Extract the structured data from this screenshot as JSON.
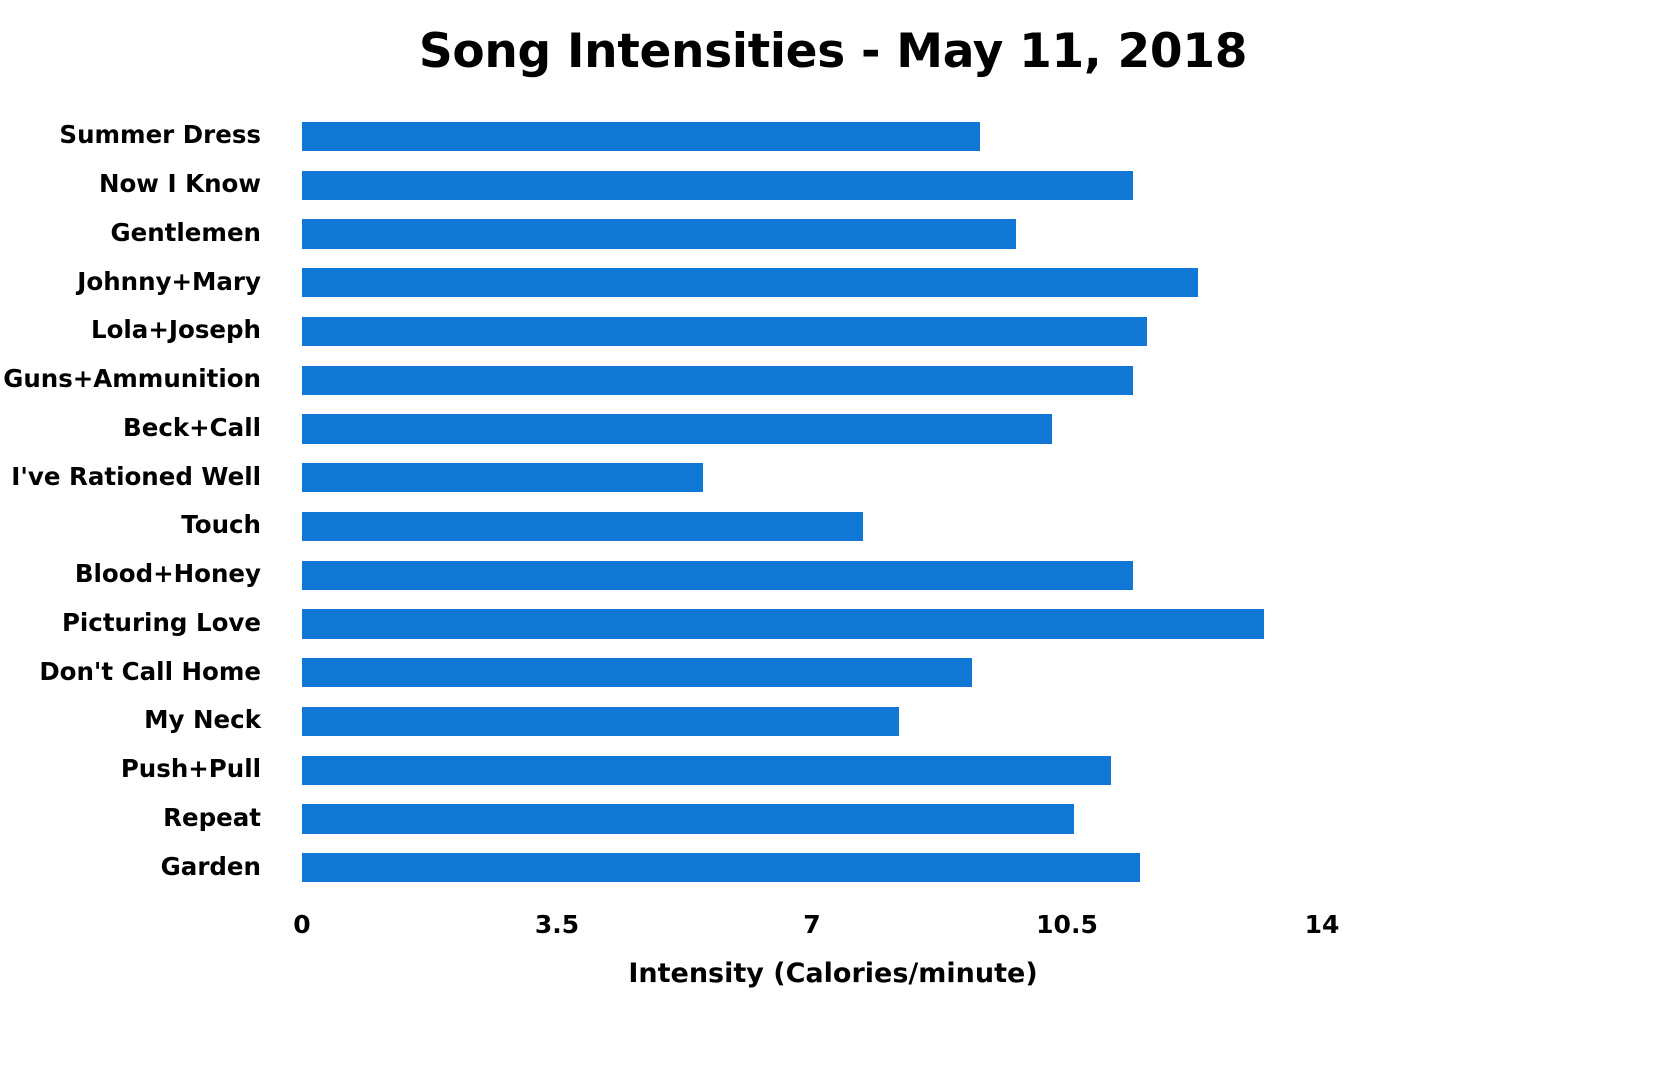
{
  "chart_data": {
    "type": "bar",
    "orientation": "horizontal",
    "title": "Song Intensities - May 11, 2018",
    "xlabel": "Intensity (Calories/minute)",
    "ylabel": "",
    "categories": [
      "Summer Dress",
      "Now I Know",
      "Gentlemen",
      "Johnny+Mary",
      "Lola+Joseph",
      "Guns+Ammunition",
      "Beck+Call",
      "I've Rationed Well",
      "Touch",
      "Blood+Honey",
      "Picturing Love",
      "Don't Call Home",
      "My Neck",
      "Push+Pull",
      "Repeat",
      "Garden"
    ],
    "values": [
      9.3,
      11.4,
      9.8,
      12.3,
      11.6,
      11.4,
      10.3,
      5.5,
      7.7,
      11.4,
      13.2,
      9.2,
      8.2,
      11.1,
      10.6,
      11.5
    ],
    "xticks": [
      0,
      3.5,
      7,
      10.5,
      14
    ],
    "xtick_labels": [
      "0",
      "3.5",
      "7",
      "10.5",
      "14"
    ],
    "xlim": [
      0,
      14
    ],
    "grid": false,
    "legend": null,
    "bar_color": "#1077d5",
    "background_color": "#ffffff",
    "text_color": "#000000"
  }
}
